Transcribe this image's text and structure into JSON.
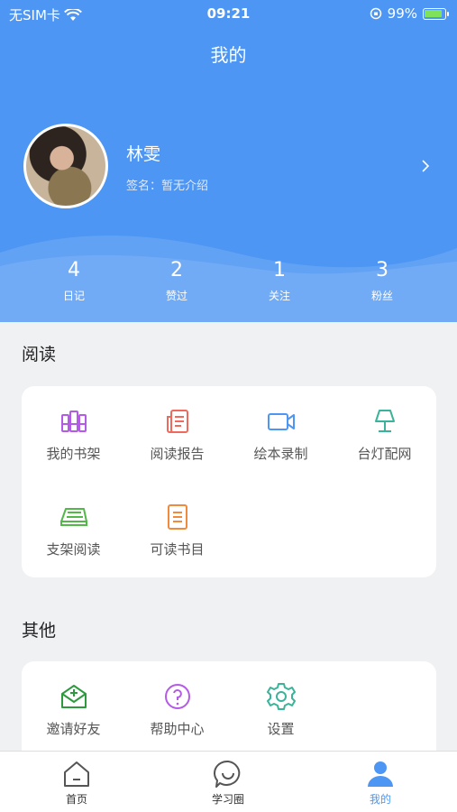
{
  "status_bar": {
    "carrier": "无SIM卡",
    "time": "09:21",
    "battery": "99%"
  },
  "header": {
    "title": "我的"
  },
  "profile": {
    "name": "林雯",
    "signature": "签名：暂无介绍"
  },
  "stats": [
    {
      "value": "4",
      "label": "日记"
    },
    {
      "value": "2",
      "label": "赞过"
    },
    {
      "value": "1",
      "label": "关注"
    },
    {
      "value": "3",
      "label": "粉丝"
    }
  ],
  "reading": {
    "title": "阅读",
    "items": [
      {
        "label": "我的书架",
        "icon": "bookshelf-icon",
        "color": "#b45be6"
      },
      {
        "label": "阅读报告",
        "icon": "report-icon",
        "color": "#ef6a5d"
      },
      {
        "label": "绘本录制",
        "icon": "video-camera-icon",
        "color": "#4d96f3"
      },
      {
        "label": "台灯配网",
        "icon": "lamp-icon",
        "color": "#3bb39a"
      },
      {
        "label": "支架阅读",
        "icon": "book-stand-icon",
        "color": "#52b848"
      },
      {
        "label": "可读书目",
        "icon": "book-list-icon",
        "color": "#f08a3c"
      }
    ]
  },
  "other": {
    "title": "其他",
    "items": [
      {
        "label": "邀请好友",
        "icon": "invite-mail-icon",
        "color": "#2e9a3e"
      },
      {
        "label": "帮助中心",
        "icon": "help-icon",
        "color": "#b45be6"
      },
      {
        "label": "设置",
        "icon": "gear-icon",
        "color": "#3bb39a"
      }
    ]
  },
  "tabbar": {
    "items": [
      {
        "label": "首页",
        "icon": "home-icon"
      },
      {
        "label": "学习圈",
        "icon": "chat-icon"
      },
      {
        "label": "我的",
        "icon": "profile-icon",
        "active": true
      }
    ],
    "active_color": "#4d96f3"
  }
}
